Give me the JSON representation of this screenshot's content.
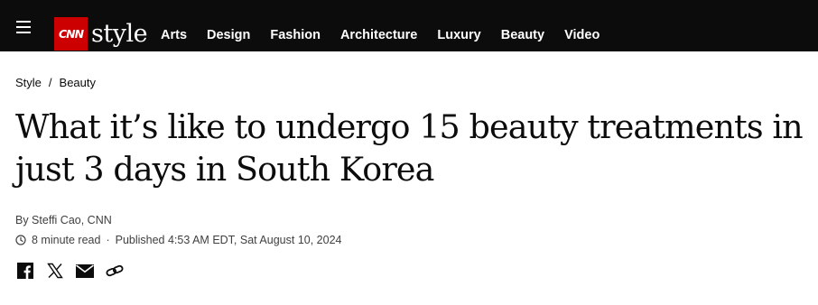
{
  "header": {
    "logo": {
      "mark": "CNN",
      "wordmark": "style"
    },
    "nav": [
      "Arts",
      "Design",
      "Fashion",
      "Architecture",
      "Luxury",
      "Beauty",
      "Video"
    ]
  },
  "breadcrumb": {
    "items": [
      "Style",
      "Beauty"
    ],
    "separator": "/"
  },
  "article": {
    "headline": "What it’s like to undergo 15 beauty treatments in just 3 days in South Korea",
    "byline": "By Steffi Cao, CNN",
    "read_time": "8 minute read",
    "separator": "·",
    "published": "Published 4:53 AM EDT, Sat August 10, 2024"
  },
  "share": [
    "facebook-icon",
    "x-icon",
    "email-icon",
    "link-icon"
  ],
  "colors": {
    "topbar": "#0c0c0c",
    "brand_red": "#cc0000",
    "text": "#0c0c0c",
    "meta_text": "#404040"
  }
}
